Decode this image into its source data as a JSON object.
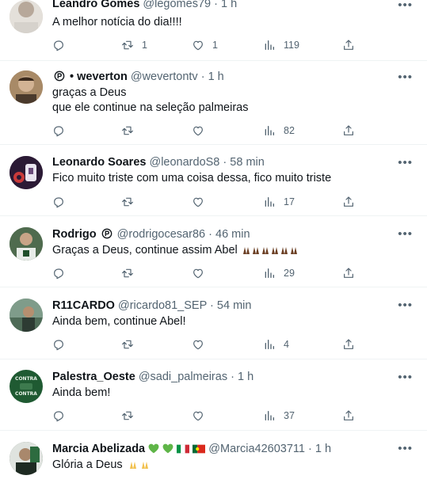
{
  "replies": [
    {
      "name": "Leandro Gomes",
      "handle": "@legomes79",
      "dot": "·",
      "time": "1 h",
      "lines": [
        "A melhor notícia do dia!!!!"
      ],
      "replies": "",
      "reposts": "1",
      "likes": "1",
      "views": "119",
      "avatar_color": "#c9c2b8"
    },
    {
      "name": "weverton",
      "name_prefix": "•",
      "handle": "@wevertontv",
      "dot": "·",
      "time": "1 h",
      "lines": [
        "graças a Deus",
        "que ele continue na seleção palmeiras"
      ],
      "replies": "",
      "reposts": "",
      "likes": "",
      "views": "82",
      "avatar_color": "#8a6d4e"
    },
    {
      "name": "Leonardo Soares",
      "handle": "@leonardoS8",
      "dot": "·",
      "time": "58 min",
      "lines": [
        "Fico muito triste com uma coisa dessa, fico muito triste"
      ],
      "replies": "",
      "reposts": "",
      "likes": "",
      "views": "17",
      "avatar_color": "#2b1a35"
    },
    {
      "name": "Rodrigo",
      "handle": "@rodrigocesar86",
      "dot": "·",
      "time": "46 min",
      "lines": [
        "Graças a Deus, continue assim Abel"
      ],
      "emoji_count": 6,
      "replies": "",
      "reposts": "",
      "likes": "",
      "views": "29",
      "avatar_color": "#3d5a3c"
    },
    {
      "name": "R11CARDO",
      "handle": "@ricardo81_SEP",
      "dot": "·",
      "time": "54 min",
      "lines": [
        "Ainda bem, continue Abel!"
      ],
      "replies": "",
      "reposts": "",
      "likes": "",
      "views": "4",
      "avatar_color": "#6d8a7a"
    },
    {
      "name": "Palestra_Oeste",
      "handle": "@sadi_palmeiras",
      "dot": "·",
      "time": "1 h",
      "lines": [
        "Ainda bem!"
      ],
      "avatar_text": [
        "CONTRA",
        "CONTRA"
      ],
      "replies": "",
      "reposts": "",
      "likes": "",
      "views": "37",
      "avatar_color": "#1f5a32"
    },
    {
      "name": "Marcia Abelizada",
      "handle": "@Marcia42603711",
      "dot": "·",
      "time": "1 h",
      "lines": [
        "Glória a Deus"
      ],
      "replies": "",
      "reposts": "",
      "likes": "",
      "views": "",
      "avatar_color": "#5d6b5e"
    }
  ],
  "colors": {
    "text": "#0f1419",
    "secondary": "#536471",
    "divider": "#eff3f4",
    "heart_emoji": "#5fb548"
  },
  "icons": [
    "reply-icon",
    "repost-icon",
    "like-icon",
    "views-icon",
    "share-icon",
    "more-icon",
    "verified-p-icon"
  ]
}
